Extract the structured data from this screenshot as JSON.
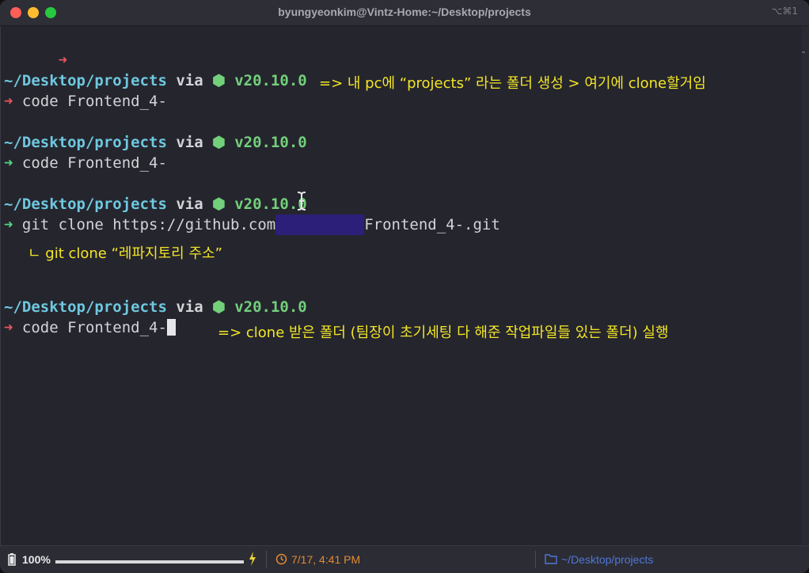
{
  "window": {
    "title": "byungyeonkim@Vintz-Home:~/Desktop/projects",
    "shortcut": "⌥⌘1"
  },
  "terminal": {
    "first_prompt_symbol": "➜",
    "blocks": [
      {
        "path": "~/Desktop/projects",
        "via": "via",
        "node_icon": "⬢",
        "version": "v20.10.0",
        "arrow": "➜",
        "command": "code Frontend_4-"
      },
      {
        "path": "~/Desktop/projects",
        "via": "via",
        "node_icon": "⬢",
        "version": "v20.10.0",
        "arrow": "➜",
        "command": "code Frontend_4-"
      },
      {
        "path": "~/Desktop/projects",
        "via": "via",
        "node_icon": "⬢",
        "version": "v20.10.0",
        "arrow": "➜",
        "command_prefix": "git clone https://github.com",
        "command_suffix": "Frontend_4-.git"
      },
      {
        "path": "~/Desktop/projects",
        "via": "via",
        "node_icon": "⬢",
        "version": "v20.10.0",
        "arrow": "➜",
        "command": "code Frontend_4-"
      }
    ]
  },
  "annotations": {
    "note1": "=> 내 pc에 “projects” 라는 폴더 생성 > 여기에 clone할거임",
    "note2": "ㄴ git clone “레파지토리 주소”",
    "note3": "=> clone 받은 폴더 (팀장이 초기세팅 다 해준 작업파일들 있는 폴더) 실행"
  },
  "statusbar": {
    "battery_label": "100%",
    "battery_level": 1.0,
    "datetime": "7/17, 4:41 PM",
    "directory": "~/Desktop/projects"
  },
  "colors": {
    "background": "#25252e",
    "path": "#6ec8df",
    "node_version": "#72d07a",
    "arrow_red": "#e8555f",
    "arrow_green": "#55d682",
    "annotation": "#f3e626",
    "redaction": "#2b1f7a",
    "time": "#e08a36",
    "directory": "#4f78d8"
  }
}
